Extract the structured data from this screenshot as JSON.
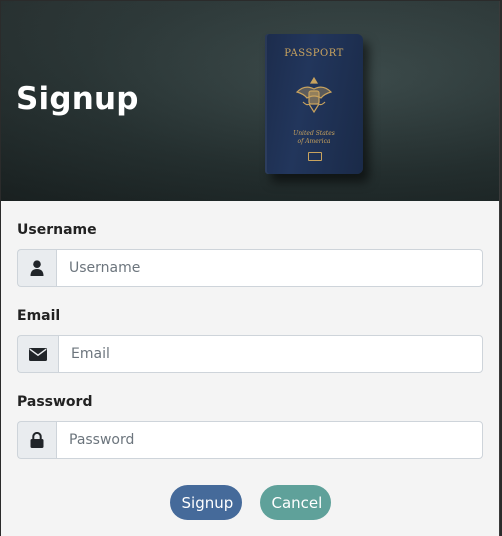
{
  "header": {
    "title": "Signup",
    "image": {
      "passport_title": "PASSPORT",
      "passport_country_line1": "United States",
      "passport_country_line2": "of America"
    }
  },
  "form": {
    "username": {
      "label": "Username",
      "placeholder": "Username",
      "value": "",
      "icon": "user-icon"
    },
    "email": {
      "label": "Email",
      "placeholder": "Email",
      "value": "",
      "icon": "envelope-icon"
    },
    "password": {
      "label": "Password",
      "placeholder": "Password",
      "value": "",
      "icon": "lock-icon"
    }
  },
  "actions": {
    "signup_label": "Signup",
    "cancel_label": "Cancel"
  },
  "colors": {
    "signup_button": "#456a9a",
    "cancel_button": "#5fa19a",
    "form_background": "#f4f4f4",
    "addon_background": "#e9ecef"
  }
}
